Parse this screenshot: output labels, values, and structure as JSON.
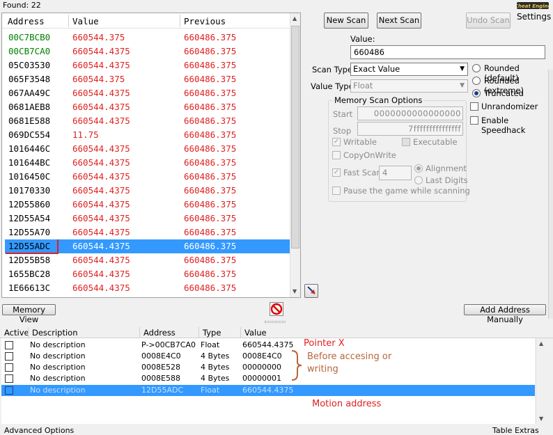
{
  "found_label": "Found: 22",
  "results": {
    "headers": {
      "address": "Address",
      "value": "Value",
      "previous": "Previous"
    },
    "rows": [
      {
        "address": "00C7BCB0",
        "value": "660544.375",
        "previous": "660486.375",
        "addr_color": "#008000"
      },
      {
        "address": "00CB7CA0",
        "value": "660544.4375",
        "previous": "660486.375",
        "addr_color": "#008000"
      },
      {
        "address": "05C03530",
        "value": "660544.4375",
        "previous": "660486.375",
        "addr_color": "#000000"
      },
      {
        "address": "065F3548",
        "value": "660544.375",
        "previous": "660486.375",
        "addr_color": "#000000"
      },
      {
        "address": "067AA49C",
        "value": "660544.4375",
        "previous": "660486.375",
        "addr_color": "#000000"
      },
      {
        "address": "0681AEB8",
        "value": "660544.4375",
        "previous": "660486.375",
        "addr_color": "#000000"
      },
      {
        "address": "0681E588",
        "value": "660544.4375",
        "previous": "660486.375",
        "addr_color": "#000000"
      },
      {
        "address": "069DC554",
        "value": "11.75",
        "previous": "660486.375",
        "addr_color": "#000000"
      },
      {
        "address": "1016446C",
        "value": "660544.4375",
        "previous": "660486.375",
        "addr_color": "#000000"
      },
      {
        "address": "101644BC",
        "value": "660544.4375",
        "previous": "660486.375",
        "addr_color": "#000000"
      },
      {
        "address": "1016450C",
        "value": "660544.4375",
        "previous": "660486.375",
        "addr_color": "#000000"
      },
      {
        "address": "10170330",
        "value": "660544.4375",
        "previous": "660486.375",
        "addr_color": "#000000"
      },
      {
        "address": "12D55860",
        "value": "660544.4375",
        "previous": "660486.375",
        "addr_color": "#000000"
      },
      {
        "address": "12D55A54",
        "value": "660544.4375",
        "previous": "660486.375",
        "addr_color": "#000000"
      },
      {
        "address": "12D55A70",
        "value": "660544.4375",
        "previous": "660486.375",
        "addr_color": "#000000"
      },
      {
        "address": "12D55ADC",
        "value": "660544.4375",
        "previous": "660486.375",
        "addr_color": "#000000",
        "selected": true
      },
      {
        "address": "12D55B58",
        "value": "660544.4375",
        "previous": "660486.375",
        "addr_color": "#000000"
      },
      {
        "address": "1655BC28",
        "value": "660544.4375",
        "previous": "660486.375",
        "addr_color": "#000000"
      },
      {
        "address": "1E66613C",
        "value": "660544.4375",
        "previous": "660486.375",
        "addr_color": "#000000"
      }
    ]
  },
  "colors": {
    "changed_value": "#e02020",
    "selection": "#3399ff",
    "annotation_brown": "#b5653a",
    "annotation_red": "#e02020"
  },
  "buttons": {
    "new_scan": "New Scan",
    "next_scan": "Next Scan",
    "undo_scan": "Undo Scan",
    "settings": "Settings",
    "memory_view": "Memory View",
    "add_address": "Add Address Manually"
  },
  "scan": {
    "value_label": "Value:",
    "value": "660486",
    "scan_type_label": "Scan Type",
    "scan_type": "Exact Value",
    "value_type_label": "Value Type",
    "value_type": "Float",
    "rounding": [
      "Rounded (default)",
      "Rounded (extreme)",
      "Truncated"
    ],
    "rounding_selected": "Truncated",
    "unrandomizer": "Unrandomizer",
    "speedhack": "Enable Speedhack"
  },
  "memory_options": {
    "title": "Memory Scan Options",
    "start_label": "Start",
    "start": "0000000000000000",
    "stop_label": "Stop",
    "stop": "7fffffffffffffff",
    "writable": "Writable",
    "executable": "Executable",
    "copy_on_write": "CopyOnWrite",
    "fast_scan": "Fast Scan",
    "fast_scan_value": "4",
    "alignment": "Alignment",
    "last_digits": "Last Digits",
    "pause": "Pause the game while scanning"
  },
  "table": {
    "headers": {
      "active": "Active",
      "description": "Description",
      "address": "Address",
      "type": "Type",
      "value": "Value"
    },
    "rows": [
      {
        "description": "No description",
        "address": "P->00CB7CA0",
        "type": "Float",
        "value": "660544.4375"
      },
      {
        "description": "No description",
        "address": "0008E4C0",
        "type": "4 Bytes",
        "value": "0008E4C0"
      },
      {
        "description": "No description",
        "address": "0008E528",
        "type": "4 Bytes",
        "value": "00000000"
      },
      {
        "description": "No description",
        "address": "0008E588",
        "type": "4 Bytes",
        "value": "00000001"
      },
      {
        "description": "No description",
        "address": "12D55ADC",
        "type": "Float",
        "value": "660544.4375",
        "selected": true
      }
    ]
  },
  "annotations": {
    "pointer": "Pointer X",
    "before_line1": "Before accesing or",
    "before_line2": "writing",
    "motion": "Motion address"
  },
  "status": {
    "advanced": "Advanced Options",
    "table_extras": "Table Extras"
  },
  "icons": {
    "logo": "cheat-engine-logo-icon",
    "pointer_scan": "pointer-arrow-icon",
    "stop": "stop-icon"
  }
}
